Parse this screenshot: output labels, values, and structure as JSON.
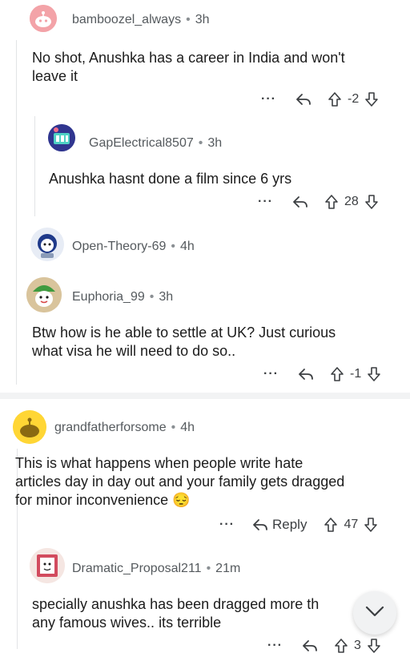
{
  "comments": {
    "c1": {
      "username": "bamboozel_always",
      "time": "3h",
      "lines": [
        "No shot, Anushka has a career in India and won't",
        "leave it"
      ],
      "score": "-2"
    },
    "c2": {
      "username": "GapElectrical8507",
      "time": "3h",
      "lines": [
        "Anushka hasnt done a film since 6 yrs"
      ],
      "score": "28"
    },
    "c3": {
      "username": "Open-Theory-69",
      "time": "4h"
    },
    "c4": {
      "username": "Euphoria_99",
      "time": "3h",
      "lines": [
        "Btw how is he able to settle at UK? Just curious",
        "what visa he will need to do so.."
      ],
      "score": "-1"
    },
    "c5": {
      "username": "grandfatherforsome",
      "time": "4h",
      "lines": [
        "This is what happens when people write hate",
        "articles day in day out and your family gets dragged",
        "for minor inconvenience"
      ],
      "emoji": "😔",
      "reply_label": "Reply",
      "score": "47"
    },
    "c6": {
      "username": "Dramatic_Proposal211",
      "time": "21m",
      "lines": [
        "specially anushka has been dragged more th",
        "any famous wives.. its terrible"
      ],
      "score": "3"
    }
  },
  "icons": [
    "more-icon",
    "share-icon",
    "upvote-icon",
    "downvote-icon",
    "chevron-down-icon"
  ],
  "colors": {
    "text": "#1c1c1c",
    "meta": "#555a5e",
    "divider": "#f2f3f4",
    "thread": "#e2e4e6"
  }
}
